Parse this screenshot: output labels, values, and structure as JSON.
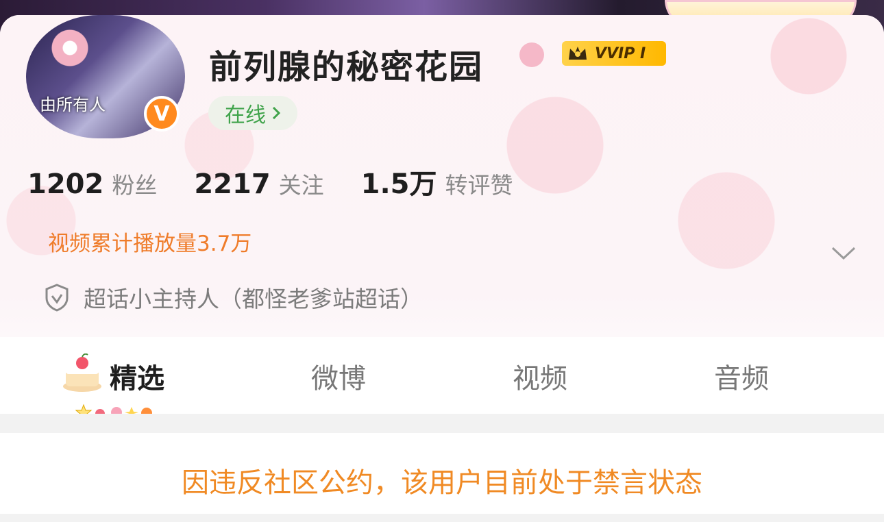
{
  "profile": {
    "username": "前列腺的秘密花园",
    "online_label": "在线",
    "vip_label": "VVIP I",
    "avatar_text": "由所有人",
    "verified_mark": "V"
  },
  "stats": [
    {
      "value": "1202",
      "label": "粉丝"
    },
    {
      "value": "2217",
      "label": "关注"
    },
    {
      "value": "1.5万",
      "label": "转评赞"
    }
  ],
  "video_views": "视频累计播放量3.7万",
  "supertopic_role": "超话小主持人（都怪老爹站超话）",
  "tabs": [
    {
      "label": "精选",
      "active": true
    },
    {
      "label": "微博",
      "active": false
    },
    {
      "label": "视频",
      "active": false
    },
    {
      "label": "音频",
      "active": false
    }
  ],
  "notice": "因违反社区公约，该用户目前处于禁言状态",
  "colors": {
    "accent_orange": "#f08a24",
    "online_green": "#3fa34a",
    "vip_gold": "#ffc21a",
    "pink_bg": "#fdf3f6"
  },
  "icons": [
    "chevron-right-icon",
    "chevron-down-icon",
    "shield-check-icon",
    "crown-icon",
    "cake-icon",
    "verified-icon"
  ]
}
